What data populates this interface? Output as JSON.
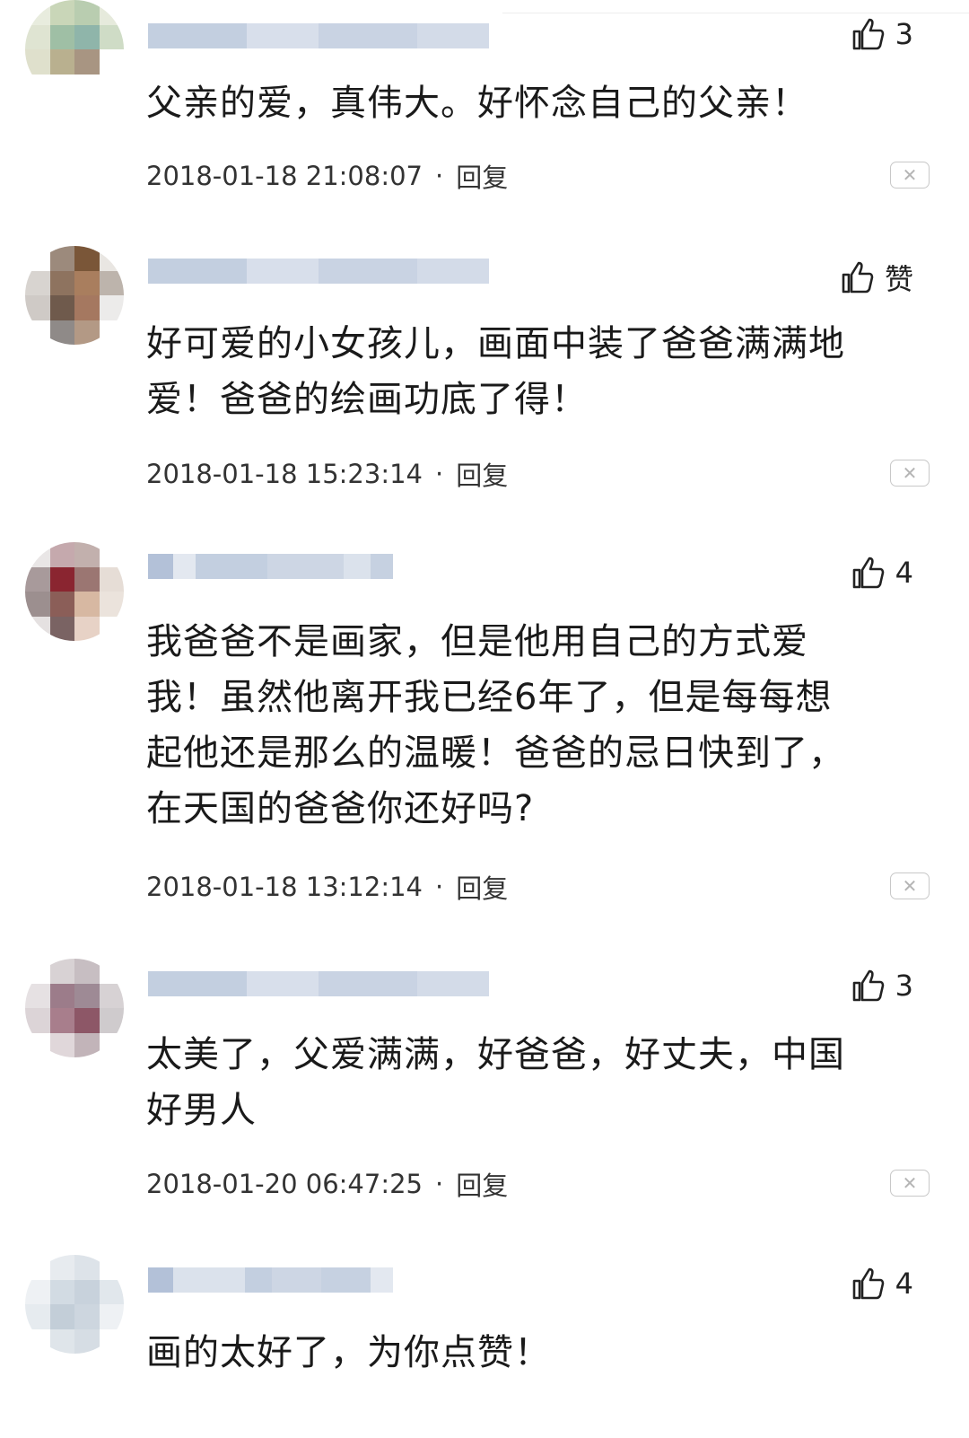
{
  "comments": [
    {
      "likes": "3",
      "text": "父亲的爱，真伟大。好怀念自己的父亲！",
      "time": "2018-01-18 21:08:07",
      "reply": "回复",
      "sep": "·",
      "close": "✕"
    },
    {
      "likes": "赞",
      "text": "好可爱的小女孩儿，画面中装了爸爸满满地\n爱！爸爸的绘画功底了得！",
      "time": "2018-01-18 15:23:14",
      "reply": "回复",
      "sep": "·",
      "close": "✕"
    },
    {
      "likes": "4",
      "text": "我爸爸不是画家，但是他用自己的方式爱\n我！虽然他离开我已经6年了，但是每每想\n起他还是那么的温暖！爸爸的忌日快到了，\n在天国的爸爸你还好吗?",
      "time": "2018-01-18 13:12:14",
      "reply": "回复",
      "sep": "·",
      "close": "✕"
    },
    {
      "likes": "3",
      "text": "太美了，父爱满满，好爸爸，好丈夫，中国\n好男人",
      "time": "2018-01-20 06:47:25",
      "reply": "回复",
      "sep": "·",
      "close": "✕"
    },
    {
      "likes": "4",
      "text": "画的太好了，为你点赞！",
      "time": "",
      "reply": "",
      "sep": "",
      "close": ""
    }
  ]
}
